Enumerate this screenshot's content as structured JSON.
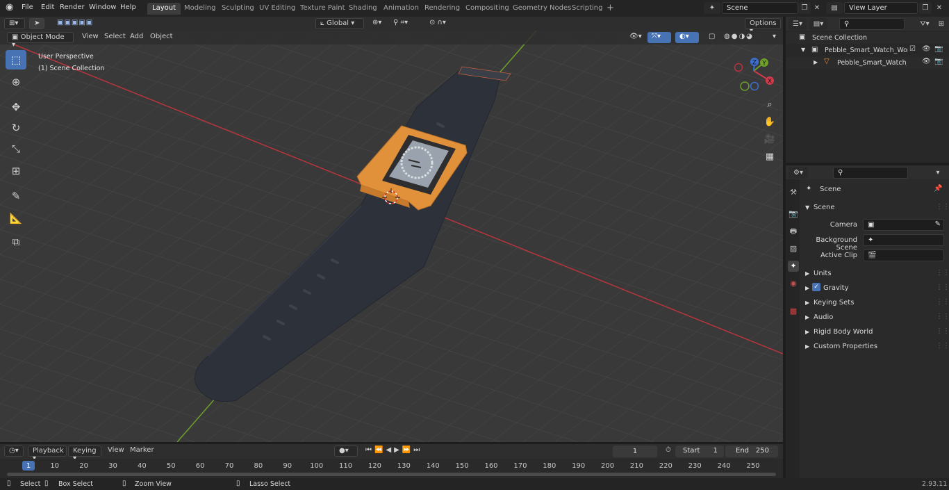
{
  "menu": [
    "File",
    "Edit",
    "Render",
    "Window",
    "Help"
  ],
  "workspaces": [
    "Layout",
    "Modeling",
    "Sculpting",
    "UV Editing",
    "Texture Paint",
    "Shading",
    "Animation",
    "Rendering",
    "Compositing",
    "Geometry Nodes",
    "Scripting"
  ],
  "scene_field": "Scene",
  "view_layer_field": "View Layer",
  "header": {
    "transform_orientation": "Global",
    "options": "Options",
    "mode": "Object Mode",
    "view": "View",
    "select": "Select",
    "add": "Add",
    "object": "Object"
  },
  "viewport": {
    "perspective": "User Perspective",
    "collection": "(1) Scene Collection",
    "axis_labels": {
      "z": "Z",
      "y": "Y",
      "x": "X"
    }
  },
  "outliner": {
    "root": "Scene Collection",
    "items": [
      "Pebble_Smart_Watch_Works_",
      "Pebble_Smart_Watch_Wc"
    ]
  },
  "properties": {
    "context": "Scene",
    "section": "Scene",
    "fields": [
      {
        "label": "Camera",
        "value": ""
      },
      {
        "label": "Background Scene",
        "value": ""
      },
      {
        "label": "Active Clip",
        "value": ""
      }
    ],
    "panels": [
      "Units",
      "Gravity",
      "Keying Sets",
      "Audio",
      "Rigid Body World",
      "Custom Properties"
    ],
    "gravity_checked": true
  },
  "timeline": {
    "playback": "Playback",
    "keying": "Keying",
    "view": "View",
    "marker": "Marker",
    "current_frame": "1",
    "start_label": "Start",
    "start": "1",
    "end_label": "End",
    "end": "250",
    "ticks": [
      "1",
      "10",
      "20",
      "30",
      "40",
      "50",
      "60",
      "70",
      "80",
      "90",
      "100",
      "110",
      "120",
      "130",
      "140",
      "150",
      "160",
      "170",
      "180",
      "190",
      "200",
      "210",
      "220",
      "230",
      "240",
      "250"
    ]
  },
  "status": {
    "select": "Select",
    "box_select": "Box Select",
    "zoom_view": "Zoom View",
    "lasso_select": "Lasso Select",
    "version": "2.93.11"
  },
  "colors": {
    "accent": "#4772b3",
    "x_axis": "#b8353d",
    "y_axis": "#6ea02a",
    "watch_body": "#e0913a",
    "strap": "#2c313a"
  }
}
